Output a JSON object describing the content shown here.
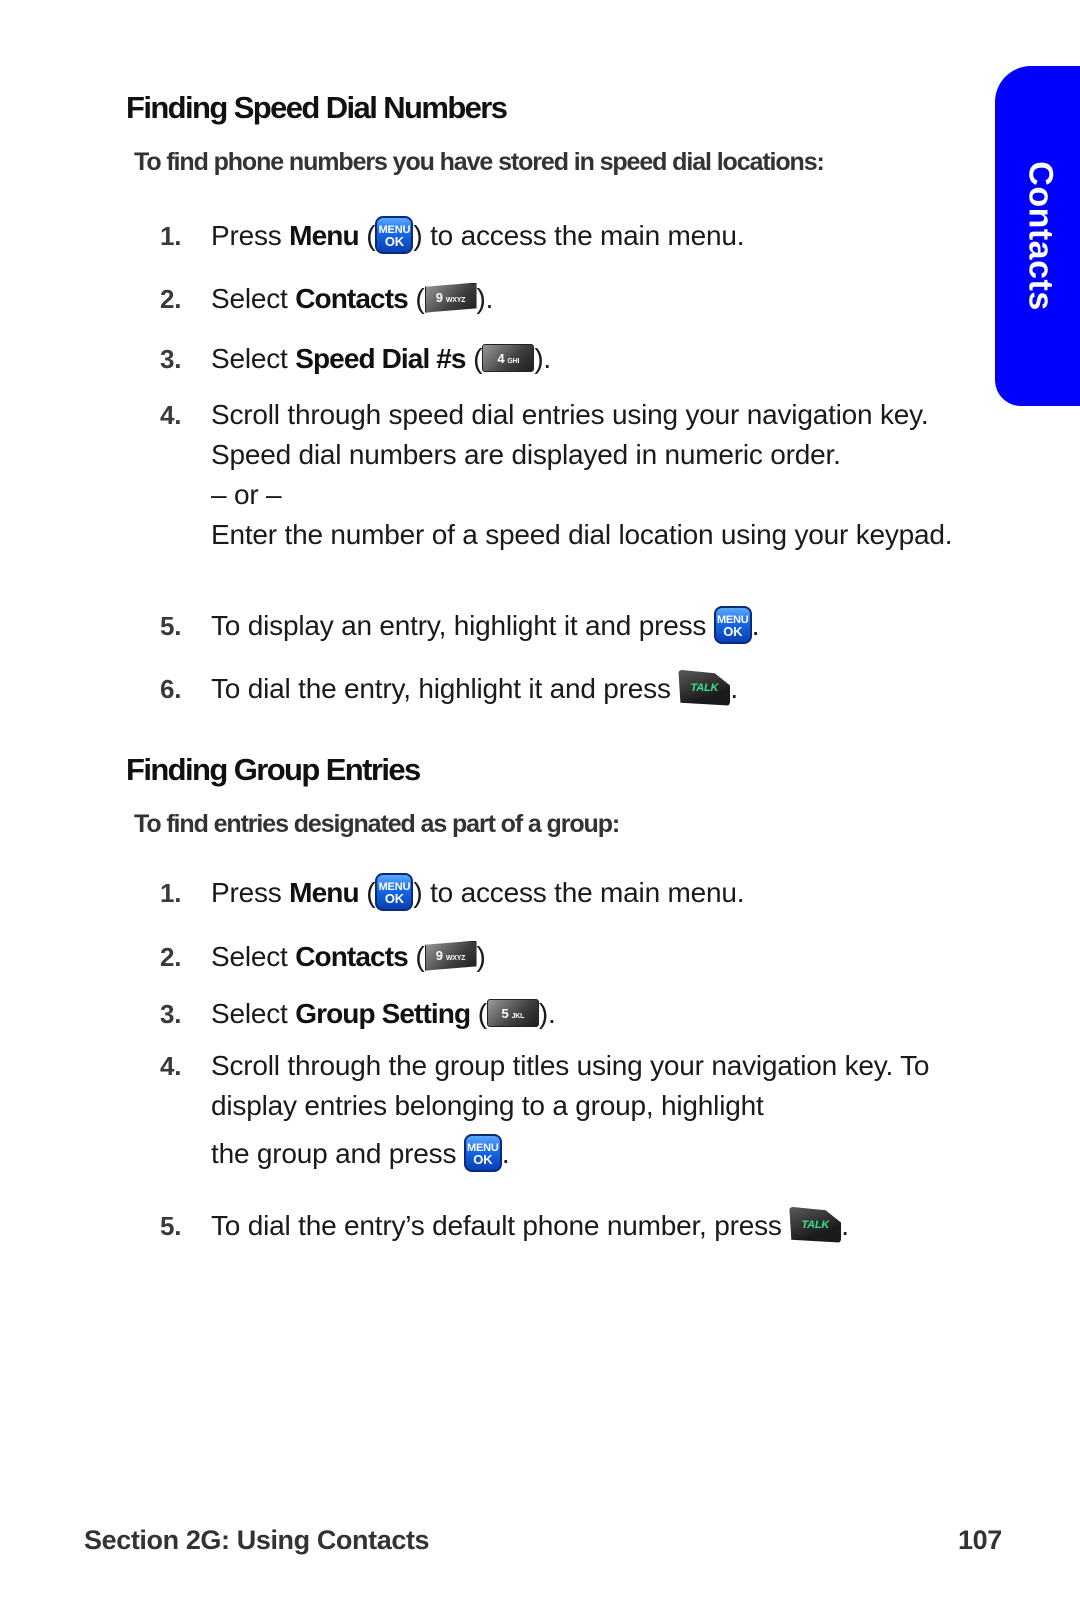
{
  "side_tab": {
    "label": "Contacts",
    "color": "#0000ff"
  },
  "section1": {
    "heading": "Finding Speed Dial Numbers",
    "intro": "To find phone numbers you have stored in speed dial locations:",
    "steps": [
      {
        "num": "1.",
        "pre": "Press ",
        "bold": "Menu",
        "mid": " (",
        "post": ") to access the main menu.",
        "key": "menu-ok"
      },
      {
        "num": "2.",
        "pre": "Select ",
        "bold": "Contacts",
        "mid": " (",
        "post": ").",
        "key": "9-wxyz"
      },
      {
        "num": "3.",
        "pre": "Select ",
        "bold": "Speed Dial #s",
        "mid": " (",
        "post": ").",
        "key": "4-ghi"
      },
      {
        "num": "4.",
        "line1": "Scroll through speed dial entries using your navigation key. Speed dial numbers are displayed in numeric order.",
        "or": "– or –",
        "line2": "Enter the number of a speed dial location using your keypad."
      },
      {
        "num": "5.",
        "pre": "To display an entry, highlight it and press ",
        "post": ".",
        "key": "menu-ok"
      },
      {
        "num": "6.",
        "pre": "To dial the entry, highlight it and press ",
        "post": ".",
        "key": "talk"
      }
    ]
  },
  "section2": {
    "heading": "Finding Group Entries",
    "intro": "To find entries designated as part of a group:",
    "steps": [
      {
        "num": "1.",
        "pre": "Press ",
        "bold": "Menu",
        "mid": " (",
        "post": ") to access the main menu.",
        "key": "menu-ok"
      },
      {
        "num": "2.",
        "pre": "Select ",
        "bold": "Contacts",
        "mid": " (",
        "post": ")",
        "key": "9-wxyz"
      },
      {
        "num": "3.",
        "pre": "Select ",
        "bold": "Group Setting",
        "mid": " (",
        "post": ").",
        "key": "5-jkl"
      },
      {
        "num": "4.",
        "line1": "Scroll through the group titles using your navigation key. To display entries belonging to a group, highlight",
        "pre": "the group and press ",
        "post": ".",
        "key": "menu-ok"
      },
      {
        "num": "5.",
        "pre": "To dial the entry’s default phone number, press ",
        "post": ".",
        "key": "talk"
      }
    ]
  },
  "keys": {
    "menu_top": "MENU",
    "menu_bottom": "OK",
    "nine_digit": "9",
    "nine_letters": "WXYZ",
    "four_digit": "4",
    "four_letters": "GHI",
    "five_digit": "5",
    "five_letters": "JKL",
    "talk": "TALK"
  },
  "footer": {
    "section": "Section 2G: Using Contacts",
    "page": "107"
  }
}
